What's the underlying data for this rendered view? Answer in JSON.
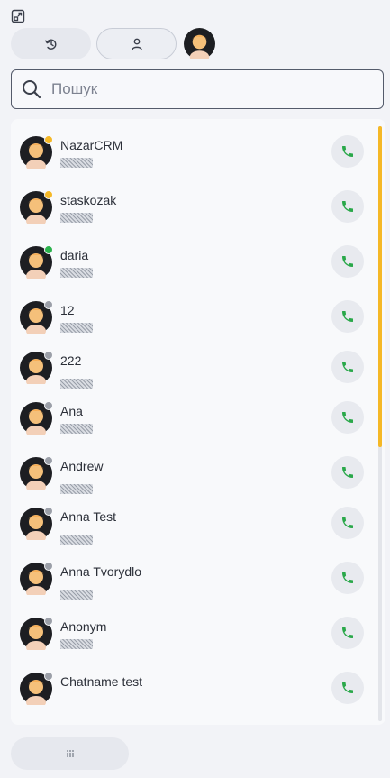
{
  "toolbar": {
    "expand_icon": "expand-icon",
    "tabs": [
      {
        "id": "history",
        "icon": "history-icon",
        "active": false
      },
      {
        "id": "contacts",
        "icon": "person-icon",
        "active": true
      }
    ]
  },
  "search": {
    "placeholder": "Пошук",
    "value": ""
  },
  "status_colors": {
    "away": "#f5b826",
    "online": "#2bb24c",
    "offline": "#9b9fa8"
  },
  "contacts": [
    {
      "name": "NazarCRM",
      "status": "away"
    },
    {
      "name": "staskozak",
      "status": "away"
    },
    {
      "name": "daria",
      "status": "online"
    },
    {
      "name": "12",
      "status": "offline"
    },
    {
      "name": "222",
      "status": "offline"
    },
    {
      "name": "Ana",
      "status": "offline"
    },
    {
      "name": "Andrew",
      "status": "offline"
    },
    {
      "name": "Anna Test",
      "status": "offline"
    },
    {
      "name": "Anna Tvorydlo",
      "status": "offline"
    },
    {
      "name": "Anonym",
      "status": "offline"
    },
    {
      "name": "Chatname test",
      "status": "offline"
    }
  ],
  "scrollbar": {
    "thumb_color": "#f5b826",
    "position_fraction": 0.0
  }
}
